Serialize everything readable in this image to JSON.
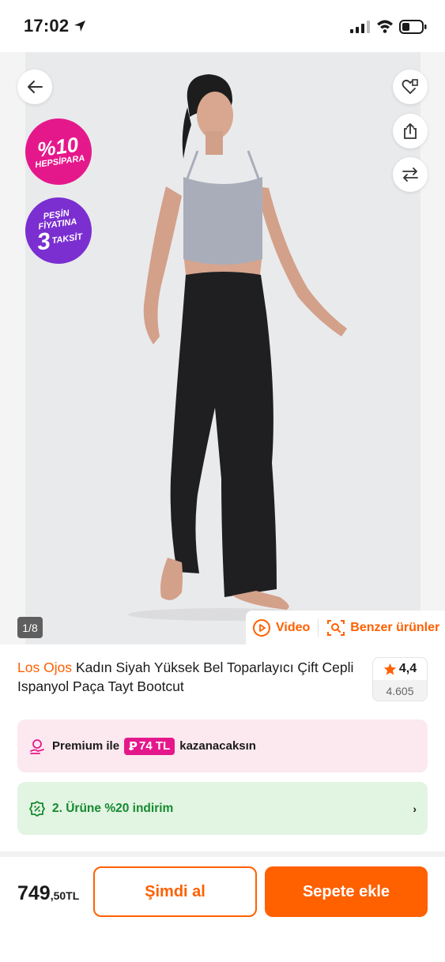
{
  "status_bar": {
    "time": "17:02"
  },
  "hero": {
    "badge_hepsipara": {
      "percent": "%10",
      "label": "HEPSİPARA"
    },
    "badge_taksit": {
      "line1": "PEŞİN",
      "line2": "FİYATINA",
      "number": "3",
      "label": "TAKSİT"
    },
    "image_counter": "1/8",
    "video_label": "Video",
    "similar_label": "Benzer ürünler"
  },
  "product": {
    "brand": "Los Ojos",
    "title": "Kadın Siyah Yüksek Bel Toparlayıcı Çift Cepli Ispanyol Paça Tayt Bootcut",
    "rating": "4,4",
    "review_count": "4.605"
  },
  "premium": {
    "prefix": "Premium ile",
    "amount": "74 TL",
    "suffix": "kazanacaksın"
  },
  "discount": {
    "text": "2. Ürüne %20 indirim"
  },
  "purchase": {
    "price_int": "749",
    "price_dec": ",50TL",
    "buy_now_label": "Şimdi al",
    "add_to_cart_label": "Sepete ekle"
  },
  "colors": {
    "accent": "#ff6000",
    "hepsipara": "#e5188b",
    "taksit": "#7b2fd0",
    "green": "#15892f"
  }
}
